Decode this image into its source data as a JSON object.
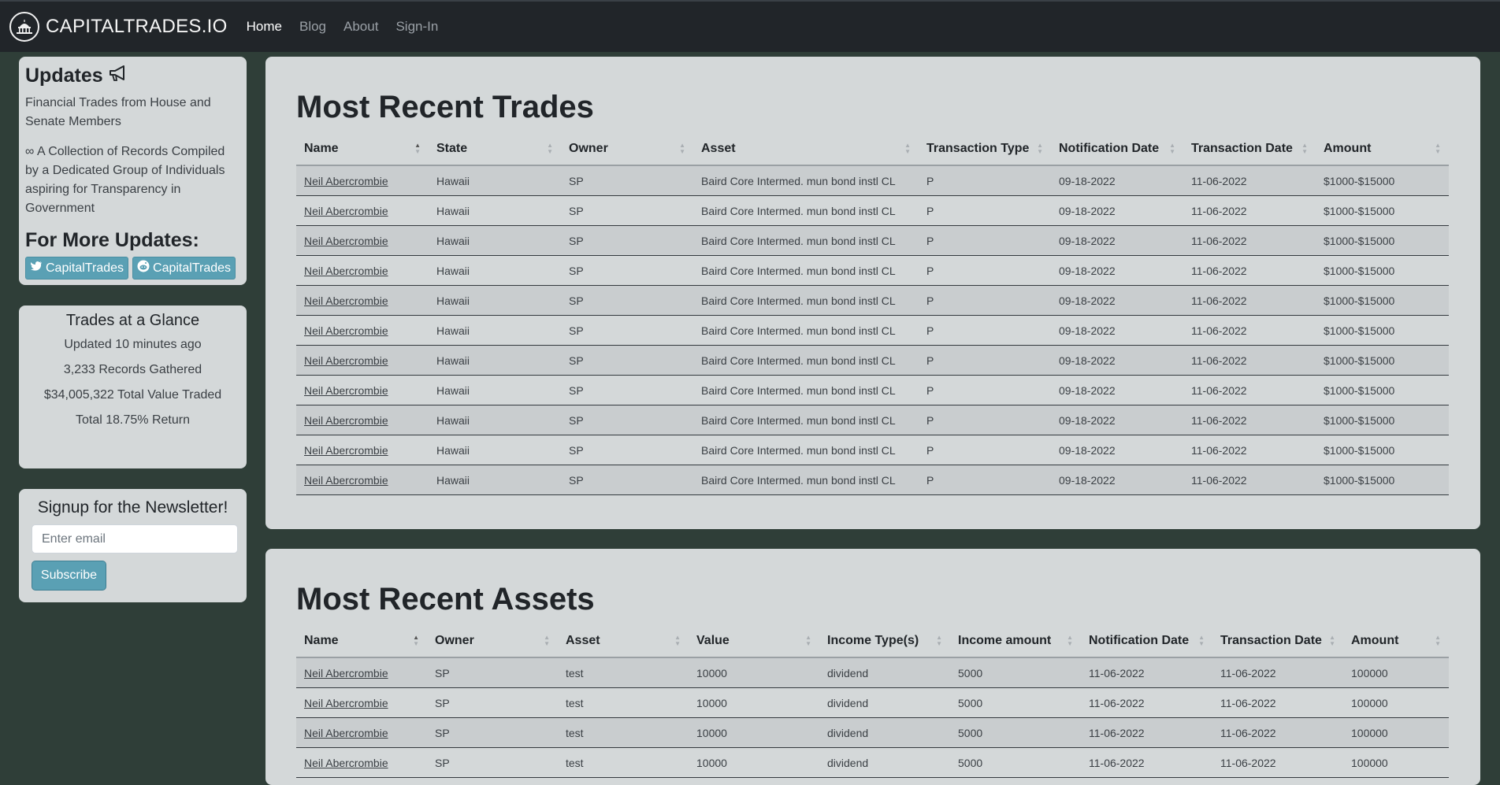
{
  "nav": {
    "brand": "CAPITALTRADES.IO",
    "links": [
      {
        "label": "Home",
        "active": true
      },
      {
        "label": "Blog",
        "active": false
      },
      {
        "label": "About",
        "active": false
      },
      {
        "label": "Sign-In",
        "active": false
      }
    ]
  },
  "sidebar": {
    "updates": {
      "title": "Updates",
      "text1": "Financial Trades from House and Senate Members",
      "text2": "∞ A Collection of Records Compiled by a Dedicated Group of Individuals aspiring for Transparency in Government",
      "more_title": "For More Updates:",
      "twitter_label": "CapitalTrades",
      "reddit_label": "CapitalTrades"
    },
    "glance": {
      "title": "Trades at a Glance",
      "updated": "Updated 10 minutes ago",
      "records": "3,233 Records Gathered",
      "total_value": "$34,005,322 Total Value Traded",
      "return": "Total 18.75% Return"
    },
    "newsletter": {
      "title": "Signup for the Newsletter!",
      "email_placeholder": "Enter email",
      "subscribe_label": "Subscribe"
    }
  },
  "trades": {
    "title": "Most Recent Trades",
    "columns": [
      "Name",
      "State",
      "Owner",
      "Asset",
      "Transaction Type",
      "Notification Date",
      "Transaction Date",
      "Amount"
    ],
    "rows": [
      [
        "Neil Abercrombie",
        "Hawaii",
        "SP",
        "Baird Core Intermed. mun bond instl CL",
        "P",
        "09-18-2022",
        "11-06-2022",
        "$1000-$15000"
      ],
      [
        "Neil Abercrombie",
        "Hawaii",
        "SP",
        "Baird Core Intermed. mun bond instl CL",
        "P",
        "09-18-2022",
        "11-06-2022",
        "$1000-$15000"
      ],
      [
        "Neil Abercrombie",
        "Hawaii",
        "SP",
        "Baird Core Intermed. mun bond instl CL",
        "P",
        "09-18-2022",
        "11-06-2022",
        "$1000-$15000"
      ],
      [
        "Neil Abercrombie",
        "Hawaii",
        "SP",
        "Baird Core Intermed. mun bond instl CL",
        "P",
        "09-18-2022",
        "11-06-2022",
        "$1000-$15000"
      ],
      [
        "Neil Abercrombie",
        "Hawaii",
        "SP",
        "Baird Core Intermed. mun bond instl CL",
        "P",
        "09-18-2022",
        "11-06-2022",
        "$1000-$15000"
      ],
      [
        "Neil Abercrombie",
        "Hawaii",
        "SP",
        "Baird Core Intermed. mun bond instl CL",
        "P",
        "09-18-2022",
        "11-06-2022",
        "$1000-$15000"
      ],
      [
        "Neil Abercrombie",
        "Hawaii",
        "SP",
        "Baird Core Intermed. mun bond instl CL",
        "P",
        "09-18-2022",
        "11-06-2022",
        "$1000-$15000"
      ],
      [
        "Neil Abercrombie",
        "Hawaii",
        "SP",
        "Baird Core Intermed. mun bond instl CL",
        "P",
        "09-18-2022",
        "11-06-2022",
        "$1000-$15000"
      ],
      [
        "Neil Abercrombie",
        "Hawaii",
        "SP",
        "Baird Core Intermed. mun bond instl CL",
        "P",
        "09-18-2022",
        "11-06-2022",
        "$1000-$15000"
      ],
      [
        "Neil Abercrombie",
        "Hawaii",
        "SP",
        "Baird Core Intermed. mun bond instl CL",
        "P",
        "09-18-2022",
        "11-06-2022",
        "$1000-$15000"
      ],
      [
        "Neil Abercrombie",
        "Hawaii",
        "SP",
        "Baird Core Intermed. mun bond instl CL",
        "P",
        "09-18-2022",
        "11-06-2022",
        "$1000-$15000"
      ]
    ]
  },
  "assets": {
    "title": "Most Recent Assets",
    "columns": [
      "Name",
      "Owner",
      "Asset",
      "Value",
      "Income Type(s)",
      "Income amount",
      "Notification Date",
      "Transaction Date",
      "Amount"
    ],
    "rows": [
      [
        "Neil Abercrombie",
        "SP",
        "test",
        "10000",
        "dividend",
        "5000",
        "11-06-2022",
        "11-06-2022",
        "100000"
      ],
      [
        "Neil Abercrombie",
        "SP",
        "test",
        "10000",
        "dividend",
        "5000",
        "11-06-2022",
        "11-06-2022",
        "100000"
      ],
      [
        "Neil Abercrombie",
        "SP",
        "test",
        "10000",
        "dividend",
        "5000",
        "11-06-2022",
        "11-06-2022",
        "100000"
      ],
      [
        "Neil Abercrombie",
        "SP",
        "test",
        "10000",
        "dividend",
        "5000",
        "11-06-2022",
        "11-06-2022",
        "100000"
      ]
    ]
  },
  "colors": {
    "navbar": "#212529",
    "background": "#2f3e38",
    "card": "#d4d8d9",
    "accent": "#5aa0b4"
  },
  "icons": {
    "logo": "capitol-building-icon",
    "updates": "megaphone-icon",
    "twitter": "twitter-icon",
    "reddit": "reddit-icon",
    "sort": "sort-icon"
  }
}
